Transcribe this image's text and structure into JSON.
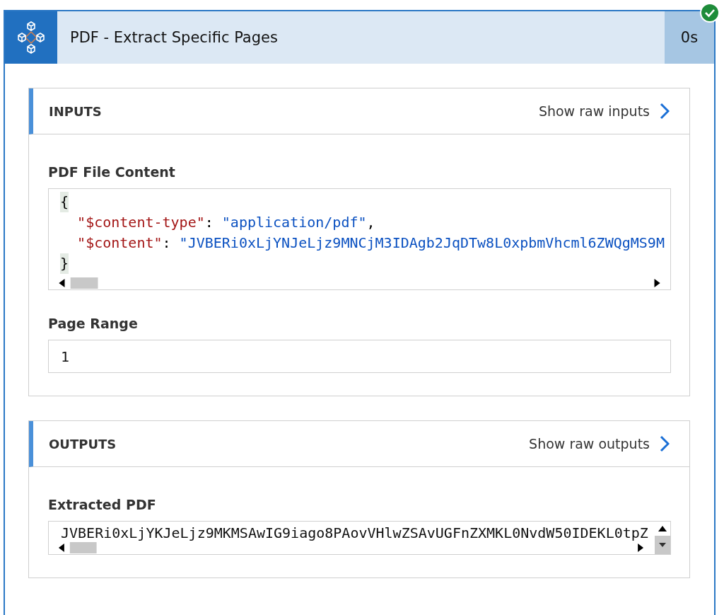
{
  "card": {
    "title": "PDF - Extract Specific Pages",
    "duration": "0s",
    "succeeded": true
  },
  "sections": [
    {
      "heading": "INPUTS",
      "raw_link": "Show raw inputs",
      "fields": [
        {
          "kind": "code",
          "label": "PDF File Content",
          "lines": [
            [
              {
                "kind": "bracket",
                "text": "{"
              }
            ],
            [
              {
                "kind": "key",
                "text": "\"$content-type\""
              },
              {
                "kind": "punct",
                "text": ": "
              },
              {
                "kind": "string",
                "text": "\"application/pdf\""
              },
              {
                "kind": "punct",
                "text": ","
              }
            ],
            [
              {
                "kind": "key",
                "text": "\"$content\""
              },
              {
                "kind": "punct",
                "text": ": "
              },
              {
                "kind": "string",
                "text": "\"JVBERi0xLjYNJeLjz9MNCjM3IDAgb2JqDTw8L0xpbmVhcml6ZWQgMS9M"
              }
            ],
            [
              {
                "kind": "bracket",
                "text": "}"
              }
            ]
          ]
        },
        {
          "kind": "text",
          "label": "Page Range",
          "value": "1"
        }
      ]
    },
    {
      "heading": "OUTPUTS",
      "raw_link": "Show raw outputs",
      "fields": [
        {
          "kind": "blob",
          "label": "Extracted PDF",
          "value": "JVBERi0xLjYKJeLjz9MKMSAwIG9iago8PAovVHlwZSAvUGFnZXMKL0NvdW50IDEKL0tpZ"
        }
      ]
    }
  ]
}
